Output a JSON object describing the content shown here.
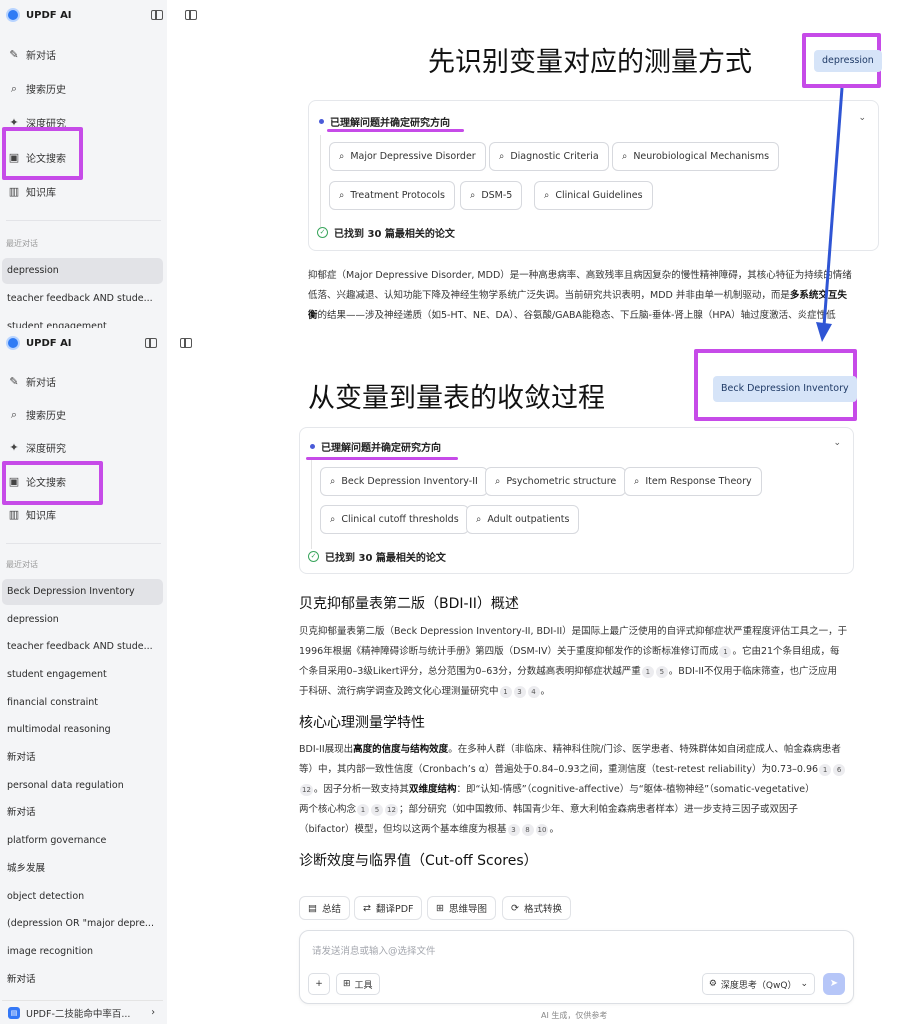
{
  "app": {
    "name": "UPDF AI"
  },
  "nav": {
    "new_chat": "新对话",
    "search_history": "搜索历史",
    "deep_research": "深度研究",
    "paper_search": "论文搜索",
    "knowledge_base": "知识库"
  },
  "sidebar_top": {
    "recent_label": "最近对话",
    "history": [
      "depression",
      "teacher feedback AND stude...",
      "student engagement"
    ]
  },
  "sidebar_bottom": {
    "recent_label": "最近对话",
    "history": [
      "Beck Depression Inventory",
      "depression",
      "teacher feedback AND stude...",
      "student engagement",
      "financial constraint",
      "multimodal reasoning",
      "新对话",
      "personal data regulation",
      "新对话",
      "platform governance",
      "城乡发展",
      "object detection",
      "(depression OR \"major depre...",
      "image recognition",
      "新对话"
    ],
    "footer": "UPDF-二技能命中率百..."
  },
  "panel1": {
    "title": "先识别变量对应的测量方式",
    "query": "depression",
    "card_title": "已理解问题并确定研究方向",
    "tags": [
      "Major Depressive Disorder",
      "Diagnostic Criteria",
      "Neurobiological Mechanisms",
      "Treatment Protocols",
      "DSM-5",
      "Clinical Guidelines"
    ],
    "found": "已找到 30 篇最相关的论文",
    "lines": [
      "抑郁症（Major Depressive Disorder, MDD）是一种高患病率、高致残率且病因复杂的慢性精神障碍，其核心特征为持续的情绪",
      "低落、兴趣减退、认知功能下降及神经生物学系统广泛失调。当前研究共识表明，MDD 并非由单一机制驱动，而是",
      "多系统交互失",
      "衡",
      "的结果——涉及神经递质（如5-HT、NE、DA）、谷氨酸/GABA能稳态、下丘脑-垂体-肾上腺（HPA）轴过度激活、炎症性低"
    ]
  },
  "panel2": {
    "title": "从变量到量表的收敛过程",
    "query": "Beck Depression Inventory",
    "card_title": "已理解问题并确定研究方向",
    "tags": [
      "Beck Depression Inventory-II",
      "Psychometric structure",
      "Item Response Theory",
      "Clinical cutoff thresholds",
      "Adult outpatients"
    ],
    "found": "已找到 30 篇最相关的论文",
    "section1": "贝克抑郁量表第二版（BDI-II）概述",
    "s1_l1": "贝克抑郁量表第二版（Beck Depression Inventory-II, BDI-II）是国际上最广泛使用的自评式抑郁症状严重程度评估工具之一，于",
    "s1_l2": "1996年根据《精神障碍诊断与统计手册》第四版（DSM-IV）关于重度抑郁发作的诊断标准修订而成",
    "s1_l2b": "。它由21个条目组成，每",
    "s1_l3": "个条目采用0–3级Likert评分，总分范围为0–63分，分数越高表明抑郁症状越严重",
    "s1_l3b": "。BDI-II不仅用于临床筛查，也广泛应用",
    "s1_l4": "于科研、流行病学调查及跨文化心理测量研究中",
    "section2": "核心心理测量学特性",
    "s2_l1a": "BDI-II展现出",
    "s2_l1b": "高度的信度与结构效度",
    "s2_l1c": "。在多种人群（非临床、精神科住院/门诊、医学患者、特殊群体如自闭症成人、帕金森病患者",
    "s2_l2": "等）中，其内部一致性信度（Cronbach’s α）普遍处于0.84–0.93之间，重测信度（test-retest reliability）为0.73–0.96",
    "s2_l3a": "。因子分析一致支持其",
    "s2_l3b": "双维度结构",
    "s2_l3c": "：即“认知-情感”（cognitive-affective）与“躯体-植物神经”（somatic-vegetative）",
    "s2_l4a": "两个核心构念",
    "s2_l4b": "；部分研究（如中国教师、韩国青少年、意大利帕金森病患者样本）进一步支持三因子或双因子",
    "s2_l5a": "（bifactor）模型，但均以这两个基本维度为根基",
    "section3": "诊断效度与临界值（Cut-off Scores）",
    "cites": {
      "c1": "1",
      "c2": "1",
      "c3": "5",
      "c4": "1",
      "c5": "3",
      "c6": "4",
      "c7": "1",
      "c8": "6",
      "c9": "12",
      "c10": "1",
      "c11": "5",
      "c12": "12",
      "c13": "3",
      "c14": "8",
      "c15": "10"
    }
  },
  "actions": [
    "总结",
    "翻译PDF",
    "思维导图",
    "格式转换"
  ],
  "input": {
    "placeholder": "请发送消息或输入@选择文件",
    "tools": "工具",
    "model": "深度思考（QwQ）"
  },
  "disclaimer": "AI 生成，仅供参考",
  "colors": {
    "highlight": "#c64be8",
    "arrow": "#2f55d4",
    "query_chip": "#d6e4f8"
  }
}
